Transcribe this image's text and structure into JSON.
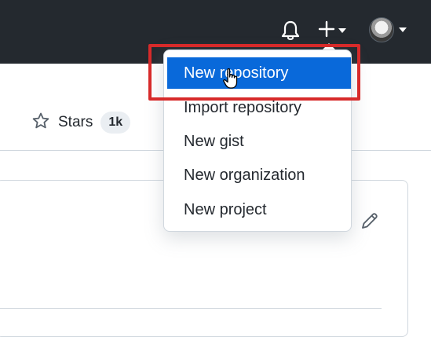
{
  "header": {
    "bell_icon": "bell-icon",
    "plus_icon": "plus-icon",
    "avatar_icon": "avatar"
  },
  "repo": {
    "stars_label": "Stars",
    "stars_count": "1k"
  },
  "create_menu": {
    "items": [
      {
        "label": "New repository"
      },
      {
        "label": "Import repository"
      },
      {
        "label": "New gist"
      },
      {
        "label": "New organization"
      },
      {
        "label": "New project"
      }
    ]
  },
  "colors": {
    "topbar": "#24292f",
    "active_item": "#0969da",
    "highlight": "#d72a2a"
  }
}
